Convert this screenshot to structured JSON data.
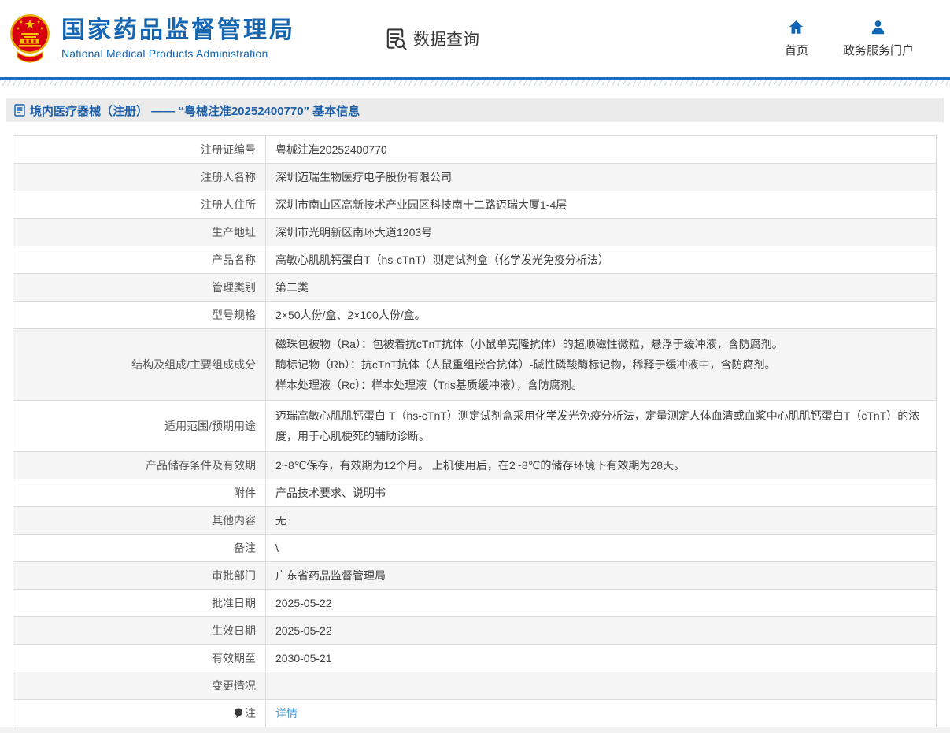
{
  "header": {
    "title": "国家药品监督管理局",
    "subtitle": "National Medical Products Administration",
    "section_label": "数据查询",
    "nav": [
      {
        "label": "首页",
        "icon": "home-icon"
      },
      {
        "label": "政务服务门户",
        "icon": "user-icon"
      }
    ]
  },
  "breadcrumb": {
    "text": "境内医疗器械（注册） —— “粤械注准20252400770” 基本信息"
  },
  "table": {
    "rows": [
      {
        "label": "注册证编号",
        "value": "粤械注准20252400770"
      },
      {
        "label": "注册人名称",
        "value": "深圳迈瑞生物医疗电子股份有限公司"
      },
      {
        "label": "注册人住所",
        "value": "深圳市南山区高新技术产业园区科技南十二路迈瑞大厦1-4层"
      },
      {
        "label": "生产地址",
        "value": "深圳市光明新区南环大道1203号"
      },
      {
        "label": "产品名称",
        "value": "高敏心肌肌钙蛋白T（hs-cTnT）测定试剂盒（化学发光免疫分析法）"
      },
      {
        "label": "管理类别",
        "value": "第二类"
      },
      {
        "label": "型号规格",
        "value": "2×50人份/盒、2×100人份/盒。"
      },
      {
        "label": "结构及组成/主要组成成分",
        "value_lines": [
          "磁珠包被物（Ra）：包被着抗cTnT抗体（小鼠单克隆抗体）的超顺磁性微粒，悬浮于缓冲液，含防腐剂。",
          "酶标记物（Rb）：抗cTnT抗体（人鼠重组嵌合抗体）-碱性磷酸酶标记物，稀释于缓冲液中，含防腐剂。",
          "样本处理液（Rc）：样本处理液（Tris基质缓冲液），含防腐剂。"
        ]
      },
      {
        "label": "适用范围/预期用途",
        "value_lines": [
          "迈瑞高敏心肌肌钙蛋白 T（hs-cTnT）测定试剂盒采用化学发光免疫分析法，定量测定人体血清或血浆中心肌肌钙蛋白T（cTnT）的浓度，用于心肌梗死的辅助诊断。"
        ]
      },
      {
        "label": "产品储存条件及有效期",
        "value": "2~8℃保存，有效期为12个月。 上机使用后，在2~8℃的储存环境下有效期为28天。"
      },
      {
        "label": "附件",
        "value": "产品技术要求、说明书"
      },
      {
        "label": "其他内容",
        "value": "无"
      },
      {
        "label": "备注",
        "value": "\\"
      },
      {
        "label": "审批部门",
        "value": "广东省药品监督管理局"
      },
      {
        "label": "批准日期",
        "value": "2025-05-22"
      },
      {
        "label": "生效日期",
        "value": "2025-05-22"
      },
      {
        "label": "有效期至",
        "value": "2030-05-21"
      },
      {
        "label": "变更情况",
        "value": ""
      },
      {
        "label": "注",
        "label_icon": "note-icon",
        "value": "详情",
        "is_link": true
      }
    ]
  },
  "colors": {
    "brand_blue": "#1565b0",
    "rule_blue": "#1b6ec2",
    "breadcrumb_blue": "#1d5fa9",
    "link_blue": "#3d96d2",
    "emblem_red": "#d7000f",
    "emblem_gold": "#f5c400",
    "alt_row_gray": "#f5f5f5",
    "bar_gray": "#ebebeb"
  }
}
